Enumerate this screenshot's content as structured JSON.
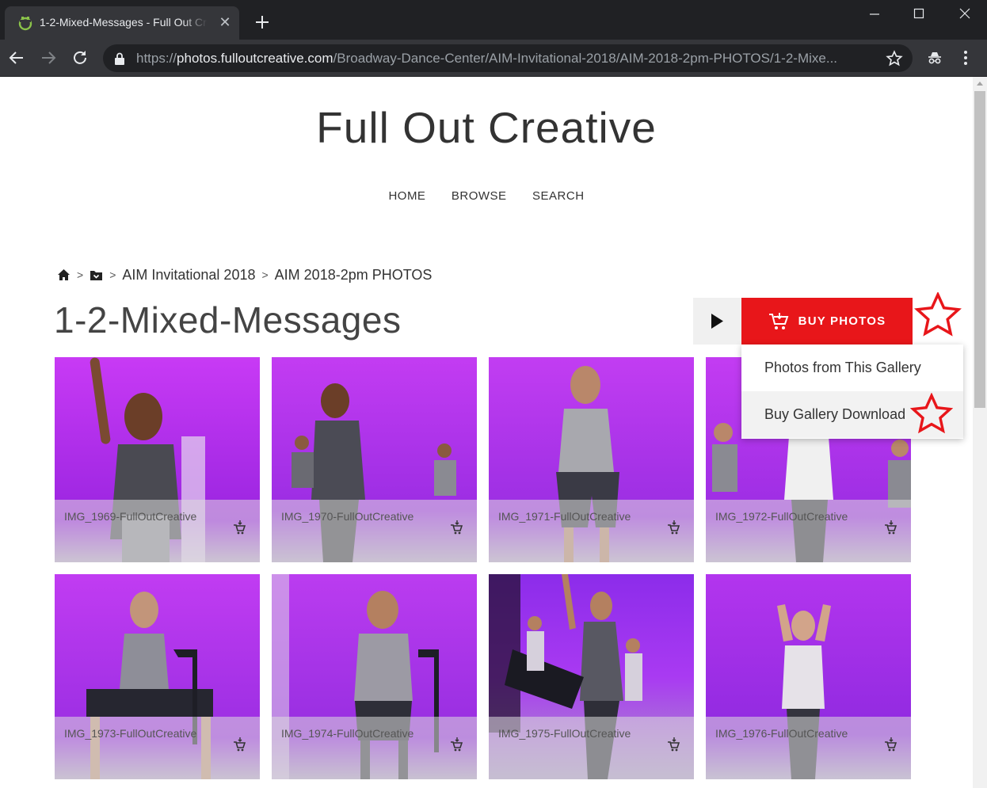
{
  "browser": {
    "tab_title": "1-2-Mixed-Messages - Full Out Creative",
    "close_glyph": "✕",
    "url_scheme": "https://",
    "url_host": "photos.fulloutcreative.com",
    "url_path": "/Broadway-Dance-Center/AIM-Invitational-2018/AIM-2018-2pm-PHOTOS/1-2-Mixe..."
  },
  "site": {
    "title": "Full Out Creative",
    "nav": [
      "HOME",
      "BROWSE",
      "SEARCH"
    ]
  },
  "breadcrumb": {
    "items": [
      "AIM Invitational 2018",
      "AIM 2018-2pm PHOTOS"
    ],
    "sep": ">"
  },
  "gallery": {
    "title": "1-2-Mixed-Messages",
    "buy_label": "BUY PHOTOS",
    "menu": [
      "Photos from This Gallery",
      "Buy Gallery Download"
    ]
  },
  "photos": [
    {
      "name": "IMG_1969-FullOutCreative"
    },
    {
      "name": "IMG_1970-FullOutCreative"
    },
    {
      "name": "IMG_1971-FullOutCreative"
    },
    {
      "name": "IMG_1972-FullOutCreative"
    },
    {
      "name": "IMG_1973-FullOutCreative"
    },
    {
      "name": "IMG_1974-FullOutCreative"
    },
    {
      "name": "IMG_1975-FullOutCreative"
    },
    {
      "name": "IMG_1976-FullOutCreative"
    }
  ],
  "colors": {
    "buy_red": "#e8161a",
    "annotation_star": "#e8161a",
    "stage_purple": "#b52ff0"
  }
}
